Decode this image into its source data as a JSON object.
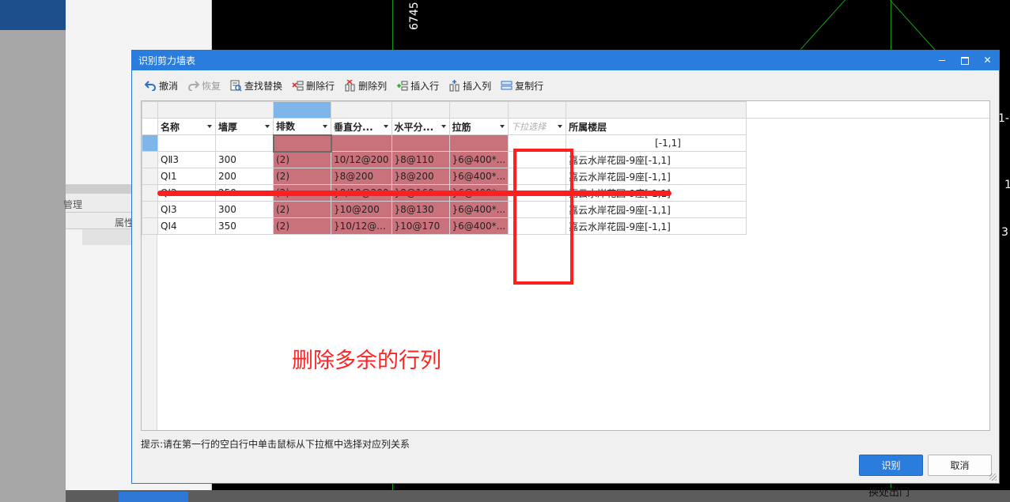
{
  "background": {
    "cad_number": "6745",
    "cad_marks": [
      "1-",
      "1",
      "3"
    ],
    "left_panel_labels": [
      "管理",
      "属性"
    ],
    "right_partial_label": "换处出门"
  },
  "dialog": {
    "title": "识别剪力墙表",
    "window_buttons": {
      "close": "✕"
    },
    "toolbar": [
      {
        "label": "撤消",
        "icon": "undo-icon",
        "enabled": true
      },
      {
        "label": "恢复",
        "icon": "redo-icon",
        "enabled": false
      },
      {
        "label": "查找替换",
        "icon": "find-replace-icon",
        "enabled": true
      },
      {
        "label": "删除行",
        "icon": "delete-row-icon",
        "enabled": true
      },
      {
        "label": "删除列",
        "icon": "delete-column-icon",
        "enabled": true
      },
      {
        "label": "插入行",
        "icon": "insert-row-icon",
        "enabled": true
      },
      {
        "label": "插入列",
        "icon": "insert-column-icon",
        "enabled": true
      },
      {
        "label": "复制行",
        "icon": "copy-row-icon",
        "enabled": true
      }
    ],
    "table": {
      "columns": [
        "名称",
        "墙厚",
        "排数",
        "垂直分...",
        "水平分...",
        "拉筋",
        "",
        "所属楼层"
      ],
      "dropdown_placeholder": "下拉选择",
      "rows": [
        [
          "QⅡ3",
          "300",
          "(2)",
          "10/12@200",
          "}8@110",
          "}6@400*...",
          "",
          "嘉云水岸花园-9座[-1,1]"
        ],
        [
          "QⅠ1",
          "200",
          "(2)",
          "}8@200",
          "}8@200",
          "}6@400*...",
          "",
          "嘉云水岸花园-9座[-1,1]"
        ],
        [
          "QⅠ2",
          "250",
          "(2)",
          "}8/10@200",
          "}8@160",
          "}6@400*...",
          "",
          "嘉云水岸花园-9座[-1,1]"
        ],
        [
          "QⅠ3",
          "300",
          "(2)",
          "}10@200",
          "}8@130",
          "}6@400*...",
          "",
          "嘉云水岸花园-9座[-1,1]"
        ],
        [
          "QⅠ4",
          "350",
          "(2)",
          "}10/12@...",
          "}10@170",
          "}6@400*...",
          "",
          "嘉云水岸花园-9座[-1,1]"
        ]
      ],
      "partial_row": [
        "",
        "",
        "",
        "",
        "",
        "",
        "",
        "[-1,1]"
      ]
    },
    "annotation_text": "删除多余的行列",
    "hint": "提示:请在第一行的空白行中单击鼠标从下拉框中选择对应列关系",
    "buttons": {
      "ok": "识别",
      "cancel": "取消"
    }
  }
}
